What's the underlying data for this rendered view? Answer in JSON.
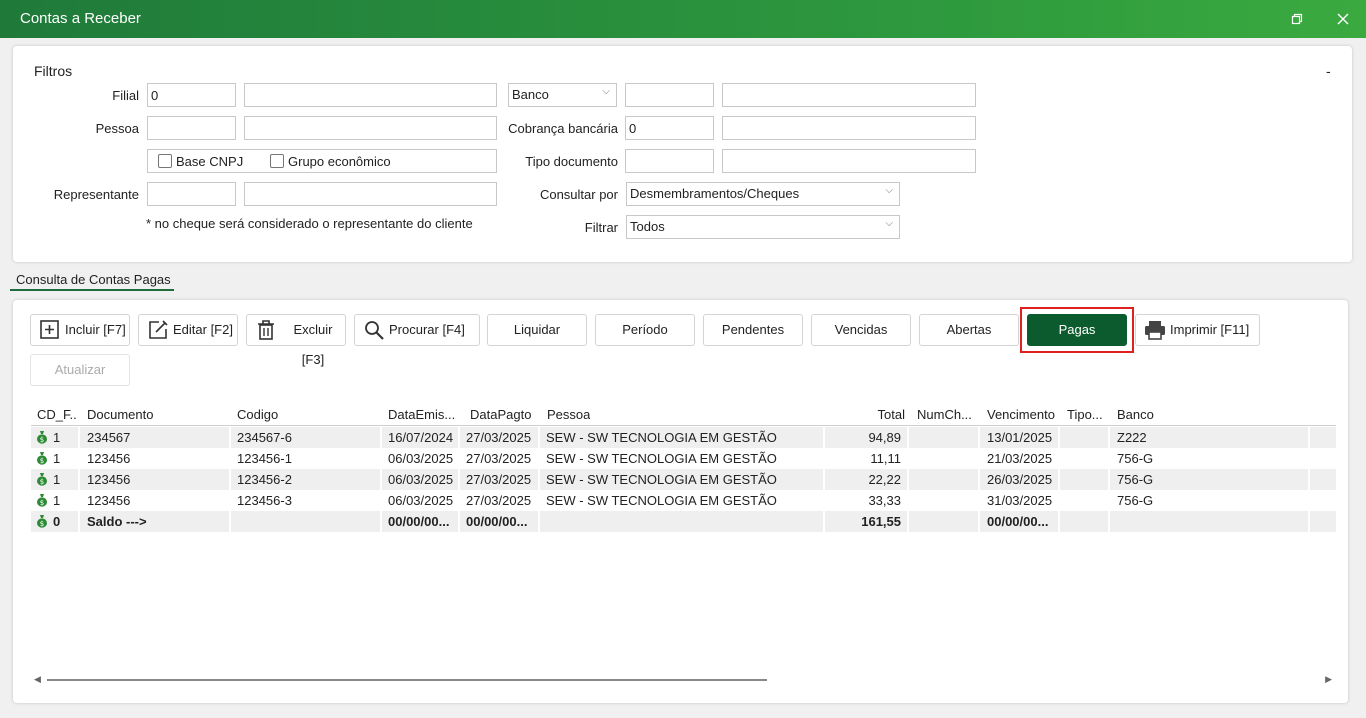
{
  "window": {
    "title": "Contas a Receber",
    "restore_icon": "restore-icon",
    "close_icon": "close-icon"
  },
  "filters": {
    "title": "Filtros",
    "collapse_label": "-",
    "filial_label": "Filial",
    "filial_code": "0",
    "filial_name": "",
    "pessoa_label": "Pessoa",
    "pessoa_code": "",
    "pessoa_name": "",
    "base_cnpj_label": "Base CNPJ",
    "grupo_economico_label": "Grupo econômico",
    "representante_label": "Representante",
    "representante_code": "",
    "representante_name": "",
    "note": "* no cheque será considerado o representante do cliente",
    "banco_label": "Banco",
    "banco_code": "",
    "banco_name": "",
    "cobranca_label": "Cobrança bancária",
    "cobranca_code": "0",
    "cobranca_name": "",
    "tipo_doc_label": "Tipo documento",
    "tipo_doc_code": "",
    "tipo_doc_name": "",
    "consultar_label": "Consultar por",
    "consultar_value": "Desmembramentos/Cheques",
    "filtrar_label": "Filtrar",
    "filtrar_value": "Todos"
  },
  "tab": {
    "label": "Consulta de Contas Pagas"
  },
  "toolbar": {
    "incluir": "Incluir [F7]",
    "editar": "Editar [F2]",
    "excluir": "Excluir [F3]",
    "procurar": "Procurar [F4]",
    "liquidar": "Liquidar",
    "periodo": "Período",
    "pendentes": "Pendentes",
    "vencidas": "Vencidas",
    "abertas": "Abertas",
    "pagas": "Pagas",
    "imprimir": "Imprimir [F11]",
    "atualizar": "Atualizar"
  },
  "grid": {
    "columns": [
      "CD_F...",
      "Documento",
      "Codigo",
      "DataEmis...",
      "DataPagto",
      "Pessoa",
      "Total",
      "NumCh...",
      "Vencimento",
      "Tipo...",
      "Banco"
    ],
    "rows": [
      {
        "cd": "1",
        "documento": "234567",
        "codigo": "234567-6",
        "emissao": "16/07/2024",
        "pagto": "27/03/2025",
        "pessoa": "SEW - SW TECNOLOGIA EM GESTÃO",
        "total": "94,89",
        "numch": "",
        "vencimento": "13/01/2025",
        "tipo": "",
        "banco": "Z222"
      },
      {
        "cd": "1",
        "documento": "123456",
        "codigo": "123456-1",
        "emissao": "06/03/2025",
        "pagto": "27/03/2025",
        "pessoa": "SEW - SW TECNOLOGIA EM GESTÃO",
        "total": "11,11",
        "numch": "",
        "vencimento": "21/03/2025",
        "tipo": "",
        "banco": "756-G"
      },
      {
        "cd": "1",
        "documento": "123456",
        "codigo": "123456-2",
        "emissao": "06/03/2025",
        "pagto": "27/03/2025",
        "pessoa": "SEW - SW TECNOLOGIA EM GESTÃO",
        "total": "22,22",
        "numch": "",
        "vencimento": "26/03/2025",
        "tipo": "",
        "banco": "756-G"
      },
      {
        "cd": "1",
        "documento": "123456",
        "codigo": "123456-3",
        "emissao": "06/03/2025",
        "pagto": "27/03/2025",
        "pessoa": "SEW - SW TECNOLOGIA EM GESTÃO",
        "total": "33,33",
        "numch": "",
        "vencimento": "31/03/2025",
        "tipo": "",
        "banco": "756-G"
      }
    ],
    "total_row": {
      "cd": "0",
      "documento": "Saldo --->",
      "codigo": "",
      "emissao": "00/00/00...",
      "pagto": "00/00/00...",
      "pessoa": "",
      "total": "161,55",
      "numch": "",
      "vencimento": "00/00/00...",
      "tipo": "",
      "banco": ""
    }
  },
  "colors": {
    "title_bar": "#2e9a3e",
    "pagas_button": "#0c5b2e",
    "highlight": "#e0201f"
  }
}
